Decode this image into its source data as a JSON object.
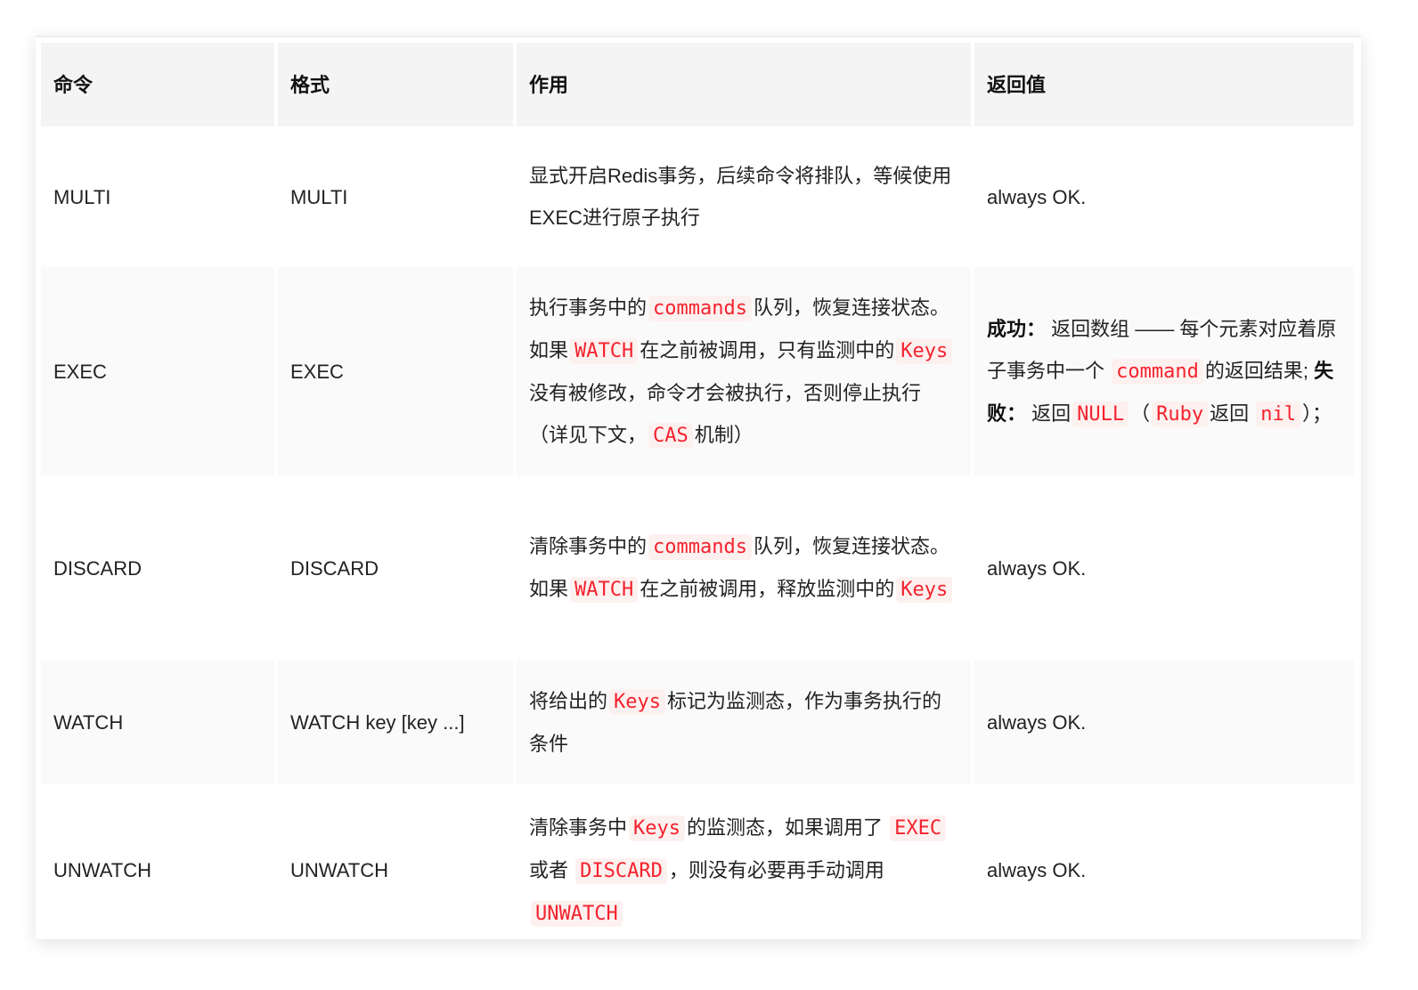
{
  "headers": [
    "命令",
    "格式",
    "作用",
    "返回值"
  ],
  "rows": [
    {
      "command": "MULTI",
      "format": "MULTI",
      "effect": [
        {
          "t": "显式开启Redis事务，后续命令将排队，等候使用EXEC进行原子执行"
        }
      ],
      "returns": [
        {
          "t": "always OK."
        }
      ]
    },
    {
      "command": "EXEC",
      "format": "EXEC",
      "effect": [
        {
          "t": "执行事务中的"
        },
        {
          "t": "commands",
          "code": true
        },
        {
          "t": "队列，恢复连接状态。如果"
        },
        {
          "t": "WATCH",
          "code": true
        },
        {
          "t": "在之前被调用，只有监测中的"
        },
        {
          "t": "Keys",
          "code": true
        },
        {
          "t": "没有被修改，命令才会被执行，否则停止执行（详见下文，"
        },
        {
          "t": "CAS",
          "code": true
        },
        {
          "t": "机制）"
        }
      ],
      "returns": [
        {
          "t": "成功：",
          "bold": true
        },
        {
          "t": " 返回数组 —— 每个元素对应着原子事务中一个 "
        },
        {
          "t": "command",
          "code": true
        },
        {
          "t": "的返回结果; "
        },
        {
          "t": "失败：",
          "bold": true
        },
        {
          "t": " 返回"
        },
        {
          "t": "NULL",
          "code": true
        },
        {
          "t": "（"
        },
        {
          "t": "Ruby",
          "code": true
        },
        {
          "t": "返回 "
        },
        {
          "t": "nil",
          "code": true
        },
        {
          "t": "）；"
        }
      ]
    },
    {
      "command": "DISCARD",
      "format": "DISCARD",
      "effect": [
        {
          "t": "清除事务中的"
        },
        {
          "t": "commands",
          "code": true
        },
        {
          "t": "队列，恢复连接状态。如果"
        },
        {
          "t": "WATCH",
          "code": true
        },
        {
          "t": "在之前被调用，释放监测中的"
        },
        {
          "t": "Keys",
          "code": true
        }
      ],
      "returns": [
        {
          "t": "always OK."
        }
      ]
    },
    {
      "command": "WATCH",
      "format": "WATCH key [key ...]",
      "effect": [
        {
          "t": "将给出的"
        },
        {
          "t": "Keys",
          "code": true
        },
        {
          "t": "标记为监测态，作为事务执行的条件"
        }
      ],
      "returns": [
        {
          "t": "always OK."
        }
      ]
    },
    {
      "command": "UNWATCH",
      "format": "UNWATCH",
      "effect": [
        {
          "t": "清除事务中"
        },
        {
          "t": "Keys",
          "code": true
        },
        {
          "t": "的监测态，如果调用了 "
        },
        {
          "t": "EXEC",
          "code": true
        },
        {
          "t": "或者 "
        },
        {
          "t": "DISCARD",
          "code": true
        },
        {
          "t": "，则没有必要再手动调用"
        },
        {
          "t": "UNWATCH",
          "code": true
        }
      ],
      "returns": [
        {
          "t": "always OK."
        }
      ]
    }
  ]
}
